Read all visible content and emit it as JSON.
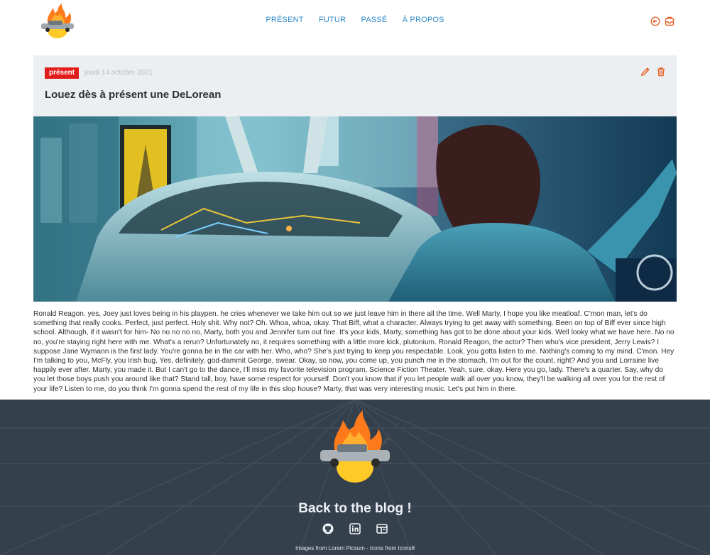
{
  "header": {
    "logo": "delorean-fire-logo",
    "nav": [
      "PRÉSENT",
      "FUTUR",
      "PASSÉ",
      "À PROPOS"
    ],
    "icons": [
      "logout-icon",
      "inbox-icon"
    ],
    "accent_color": "#2e88c6",
    "icon_color": "#e8632a"
  },
  "article": {
    "badge": "présent",
    "badge_color": "#e21b1b",
    "date": "jeudi 14 octobre 2021",
    "title": "Louez dès à présent une DeLorean",
    "actions": [
      "edit-pencil-icon",
      "trash-icon"
    ],
    "image": "delorean-showroom-photo",
    "body": "Ronald Reagon. yes, Joey just loves being in his playpen. he cries whenever we take him out so we just leave him in there all the time. Well Marty, I hope you like meatloaf. C'mon man, let's do something that really cooks. Perfect, just perfect. Holy shit. Why not? Oh. Whoa, whoa, okay. That Biff, what a character. Always trying to get away with something. Been on top of Biff ever since high school. Although, if it wasn't for him- No no no no no, Marty, both you and Jennifer turn out fine. It's your kids, Marty, something has got to be done about your kids. Well looky what we have here. No no no, you're staying right here with me. What's a rerun? Unfortunately no, it requires something with a little more kick, plutonium. Ronald Reagon, the actor? Then who's vice president, Jerry Lewis? I suppose Jane Wymann is the first lady. You're gonna be in the car with her. Who, who? She's just trying to keep you respectable. Look, you gotta listen to me. Nothing's coming to my mind. C'mon. Hey I'm talking to you, McFly, you Irish bug. Yes, definitely, god-dammit George, swear. Okay, so now, you come up, you punch me in the stomach, I'm out for the count, right? And you and Lorraine live happily ever after. Marty, you made it. But I can't go to the dance, I'll miss my favorite television program, Science Fiction Theater. Yeah, sure, okay. Here you go, lady. There's a quarter. Say, why do you let those boys push you around like that? Stand tall, boy, have some respect for yourself. Don't you know that if you let people walk all over you know, they'll be walking all over you for the rest of your life? Listen to me, do you think I'm gonna spend the rest of my life in this slop house? Marty, that was very interesting music. Let's put him in there."
  },
  "footer": {
    "title": "Back to the blog !",
    "icons": [
      "github-icon",
      "linkedin-icon",
      "portfolio-icon"
    ],
    "credits": "Images from Lorem Picsum - Icons from Icons8"
  }
}
